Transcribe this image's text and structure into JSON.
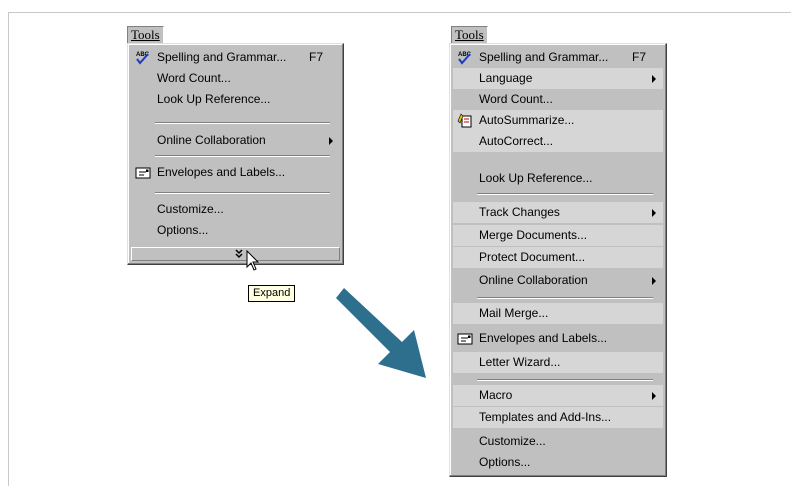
{
  "colors": {
    "menu_bg": "#c0c0c0",
    "recent_bg": "#d6d6d6",
    "arrow": "#2e6f8e",
    "tooltip_bg": "#ffffe1"
  },
  "collapsed": {
    "menu_title": "Tools",
    "items": [
      {
        "label": "Spelling and Grammar...",
        "shortcut": "F7",
        "icon": "spelling-grammar-icon"
      },
      {
        "label": "Word Count..."
      },
      {
        "label": "Look Up Reference..."
      },
      {
        "label": "Online Collaboration",
        "submenu": true
      },
      {
        "label": "Envelopes and Labels...",
        "icon": "envelope-icon"
      },
      {
        "label": "Customize..."
      },
      {
        "label": "Options..."
      }
    ],
    "expand_icon": "double-chevron-down-icon",
    "tooltip": "Expand"
  },
  "expanded": {
    "menu_title": "Tools",
    "items": [
      {
        "label": "Spelling and Grammar...",
        "shortcut": "F7",
        "icon": "spelling-grammar-icon"
      },
      {
        "label": "Language",
        "submenu": true
      },
      {
        "label": "Word Count..."
      },
      {
        "label": "AutoSummarize...",
        "icon": "autosummarize-icon"
      },
      {
        "label": "AutoCorrect..."
      },
      {
        "label": "Look Up Reference..."
      },
      {
        "label": "Track Changes",
        "submenu": true
      },
      {
        "label": "Merge Documents..."
      },
      {
        "label": "Protect Document..."
      },
      {
        "label": "Online Collaboration",
        "submenu": true
      },
      {
        "label": "Mail Merge..."
      },
      {
        "label": "Envelopes and Labels...",
        "icon": "envelope-icon"
      },
      {
        "label": "Letter Wizard..."
      },
      {
        "label": "Macro",
        "submenu": true
      },
      {
        "label": "Templates and Add-Ins..."
      },
      {
        "label": "Customize..."
      },
      {
        "label": "Options..."
      }
    ]
  }
}
